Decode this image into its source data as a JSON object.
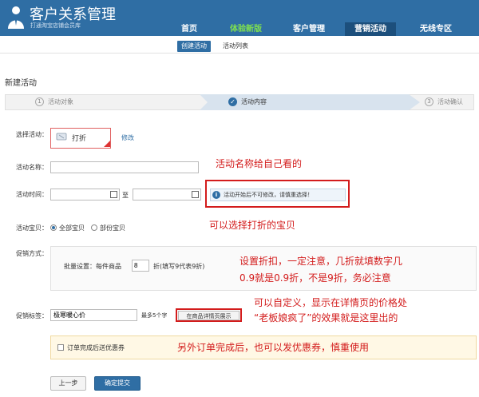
{
  "header": {
    "title": "客户关系管理",
    "subtitle": "打通淘宝店铺会员库",
    "nav": [
      {
        "label": "首页"
      },
      {
        "label": "体验新版"
      },
      {
        "label": "客户管理"
      },
      {
        "label": "营销活动"
      },
      {
        "label": "无线专区"
      }
    ]
  },
  "subnav": {
    "create": "创建活动",
    "list": "活动列表"
  },
  "page_title": "新建活动",
  "steps": [
    {
      "num": "1",
      "label": "活动对象"
    },
    {
      "num": "",
      "label": "活动内容"
    },
    {
      "num": "3",
      "label": "活动确认"
    }
  ],
  "form": {
    "type_label": "选择活动：",
    "type_value": "打折",
    "edit_link": "修改",
    "name_label": "活动名称：",
    "name_value": "",
    "time_label": "活动时间：",
    "time_to": "至",
    "time_hint": "活动开始后不可修改，请慎重选择！",
    "items_label": "活动宝贝：",
    "items_all": "全部宝贝",
    "items_partial": "部份宝贝",
    "promo_label": "促销方式：",
    "batch_label": "批量设置：每件商品",
    "batch_value": "8",
    "batch_suffix": "折(填写9代表9折)",
    "tag_label": "促销标签：",
    "tag_value": "极寒暖心价",
    "tag_limit": "最多5个字",
    "tag_button": "在商品详情页展示",
    "coupon_label": "订单完成后送优惠券"
  },
  "buttons": {
    "prev": "上一步",
    "submit": "确定提交"
  },
  "annotations": {
    "name_note": "活动名称给自己看的",
    "items_note": "可以选择打折的宝贝",
    "promo_note_1": "设置折扣，一定注意，几折就填数字几",
    "promo_note_2": "0.9就是0.9折，不是9折，务必注意",
    "tag_note_1": "可以自定义，显示在详情页的价格处",
    "tag_note_2": "“老板娘疯了”的效果就是这里出的",
    "coupon_note": "另外订单完成后，也可以发优惠券，慎重使用"
  },
  "colors": {
    "brand": "#2f6ea4",
    "annotation": "#d31c1c",
    "nav_highlight": "#7fe04f"
  }
}
